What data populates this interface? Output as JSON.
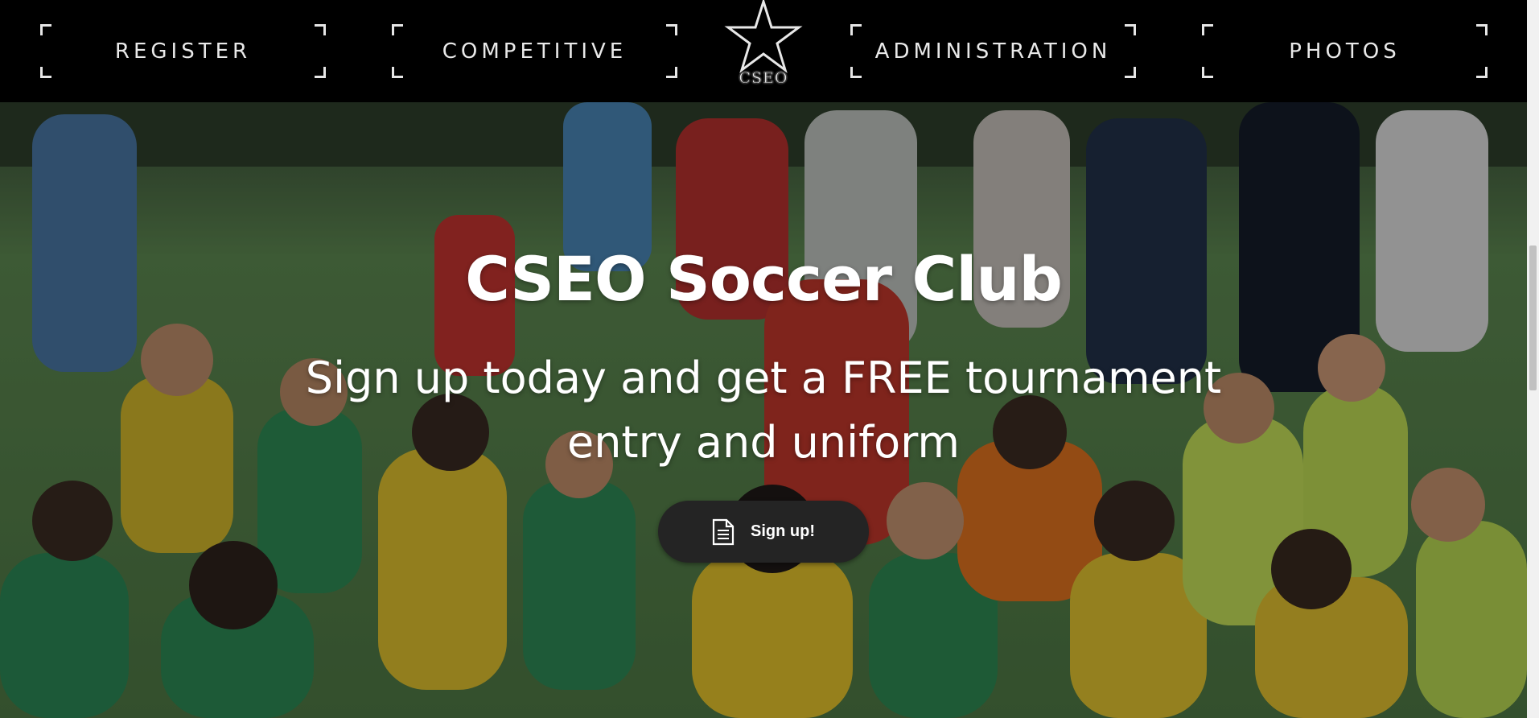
{
  "nav": {
    "items": [
      {
        "label": "REGISTER"
      },
      {
        "label": "COMPETITIVE"
      },
      {
        "label": "ADMINISTRATION"
      },
      {
        "label": "PHOTOS"
      }
    ],
    "logo": {
      "text": "CSEO",
      "icon": "star-icon"
    }
  },
  "hero": {
    "title": "CSEO Soccer Club",
    "subtitle": "Sign up today and get a FREE tournament entry and uniform",
    "button": {
      "label": "Sign up!",
      "icon": "document-icon"
    },
    "background": "photo of children's soccer teams gathered on a field"
  },
  "colors": {
    "nav_bg": "#000000",
    "button_bg": "#242424",
    "text": "#ffffff"
  }
}
